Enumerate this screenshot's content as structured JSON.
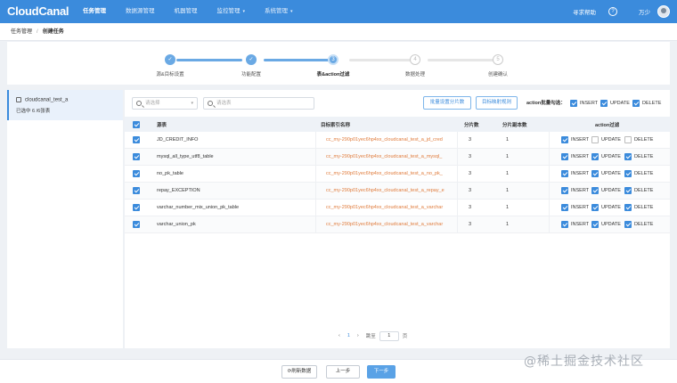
{
  "app": {
    "logo": "CloudCanal"
  },
  "nav": {
    "items": [
      "任务管理",
      "数据源管理",
      "机器管理",
      "监控管理",
      "系统管理"
    ],
    "help": "寻求帮助",
    "help_icon_glyph": "?",
    "user": "万少",
    "caret": "▾"
  },
  "breadcrumb": {
    "root": "任务管理",
    "sep": "/",
    "current": "创建任务"
  },
  "steps": [
    {
      "label": "源&目标设置",
      "status": "done",
      "glyph": "✓"
    },
    {
      "label": "功能配置",
      "status": "done",
      "glyph": "✓"
    },
    {
      "label": "表&action过滤",
      "status": "current",
      "glyph": "3"
    },
    {
      "label": "数据处理",
      "status": "todo",
      "glyph": "4"
    },
    {
      "label": "创建确认",
      "status": "todo",
      "glyph": "5"
    }
  ],
  "left": {
    "db_name": "cloudcanal_test_a",
    "selected": "已选中 6 /6张表"
  },
  "toolbar": {
    "select_placeholder": "请选择",
    "search_placeholder": "请选表",
    "bulk_shard_button": "批量设置分片数",
    "mapping_rule_button": "目标映射规则",
    "action_label": "action批量勾选：",
    "action_insert": "INSERT",
    "action_update": "UPDATE",
    "action_delete": "DELETE",
    "action_insert_checked": true,
    "action_update_checked": true,
    "action_delete_checked": true
  },
  "table": {
    "headers": {
      "source": "源表",
      "target": "目标索引名称",
      "shards": "分片数",
      "replicas": "分片副本数",
      "action": "action过滤"
    },
    "action_labels": {
      "insert": "INSERT",
      "update": "UPDATE",
      "delete": "DELETE"
    },
    "rows": [
      {
        "source": "JD_CREDIT_INFO",
        "target": "cc_my-290p01yec6hp4xx_cloudcanal_test_a_jd_cred",
        "shards": "3",
        "replicas": "1",
        "insert": true,
        "update": false,
        "delete": false
      },
      {
        "source": "mysql_all_type_utf8_table",
        "target": "cc_my-290p01yec6hp4xx_cloudcanal_test_a_mysql_",
        "shards": "3",
        "replicas": "1",
        "insert": true,
        "update": true,
        "delete": true
      },
      {
        "source": "no_pk_table",
        "target": "cc_my-290p01yec6hp4xx_cloudcanal_test_a_no_pk_",
        "shards": "3",
        "replicas": "1",
        "insert": true,
        "update": true,
        "delete": true
      },
      {
        "source": "repay_EXCEPTION",
        "target": "cc_my-290p01yec6hp4xx_cloudcanal_test_a_repay_e",
        "shards": "3",
        "replicas": "1",
        "insert": true,
        "update": true,
        "delete": true
      },
      {
        "source": "varchar_number_mix_union_pk_table",
        "target": "cc_my-290p01yec6hp4xx_cloudcanal_test_a_varchar",
        "shards": "3",
        "replicas": "1",
        "insert": true,
        "update": true,
        "delete": true
      },
      {
        "source": "varchar_union_pk",
        "target": "cc_my-290p01yec6hp4xx_cloudcanal_test_a_varchar",
        "shards": "3",
        "replicas": "1",
        "insert": true,
        "update": true,
        "delete": true
      }
    ]
  },
  "pager": {
    "prev": "‹",
    "current": "1",
    "next": "›",
    "goto_label": "跳至",
    "goto_value": "1",
    "goto_suffix": "页"
  },
  "footer": {
    "refresh": "⟳刷新数据",
    "prev": "上一步",
    "next": "下一步"
  },
  "watermark": "@稀土掘金技术社区",
  "colors": {
    "accent": "#3b8bdc",
    "target_text": "#e07b3b",
    "topbar": "#3b8bdc"
  }
}
